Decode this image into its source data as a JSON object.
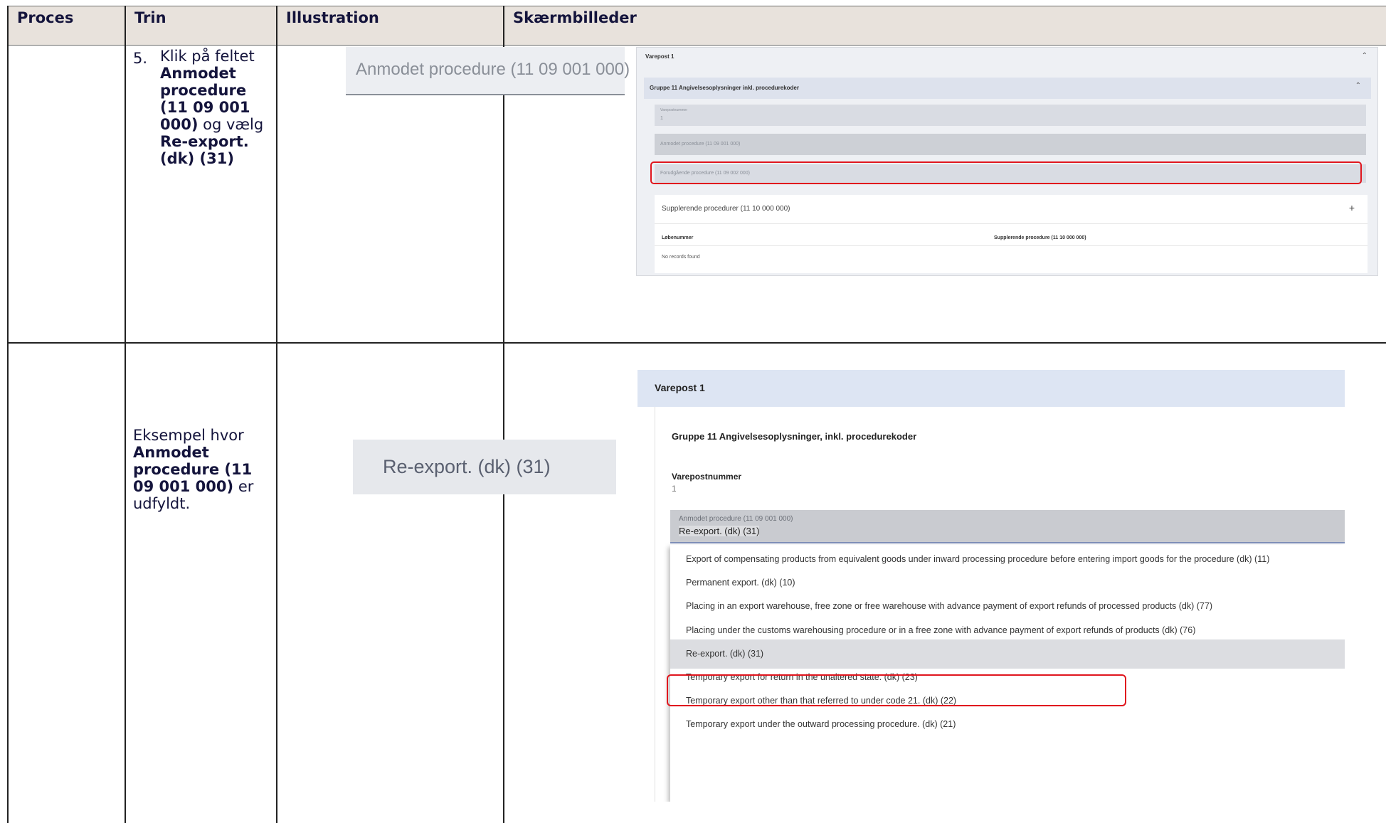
{
  "header": {
    "columns": [
      "Proces",
      "Trin",
      "Illustration",
      "Skærmbilleder"
    ]
  },
  "row1": {
    "step_number": "5.",
    "text_1": "Klik på feltet",
    "bold_1": "Anmodet procedure (11 09 001 000)",
    "text_2": "og vælg",
    "bold_2": "Re-export. (dk) (31)",
    "illustration_text": "Anmodet procedure (11 09 001 000)",
    "screenshot": {
      "title": "Varepost 1",
      "group_title": "Gruppe 11 Angivelsesoplysninger inkl. procedurekoder",
      "field_varepostnummer_label": "Varepostnummer",
      "field_varepostnummer_value": "1",
      "field_anmodet": "Anmodet procedure (11 09 001 000)",
      "field_forudgaaende": "Forudgående procedure (11 09 002 000)",
      "sub_title": "Supplerende procedurer (11 10 000 000)",
      "col_loebenummer": "Løbenummer",
      "col_supplerende": "Supplerende procedure (11 10 000 000)",
      "no_records": "No records found"
    }
  },
  "row2": {
    "text_1": "Eksempel hvor",
    "bold_1": "Anmodet procedure (11 09 001 000)",
    "text_2": "er udfyldt.",
    "illustration_text": "Re-export. (dk) (31)",
    "screenshot": {
      "title": "Varepost 1",
      "group_title": "Gruppe 11 Angivelsesoplysninger, inkl. procedurekoder",
      "varepostnummer_label": "Varepostnummer",
      "varepostnummer_value": "1",
      "select_label": "Anmodet procedure (11 09 001 000)",
      "select_value": "Re-export. (dk) (31)",
      "options": [
        "Export of compensating products from equivalent goods under inward processing procedure before entering import goods for the procedure (dk) (11)",
        "Permanent export. (dk) (10)",
        "Placing in an export warehouse, free zone or free warehouse with advance payment of export refunds of processed products (dk) (77)",
        "Placing under the customs warehousing procedure or in a free zone with advance payment of export refunds of products (dk) (76)",
        "Re-export. (dk) (31)",
        "Temporary export for return in the unaltered state. (dk) (23)",
        "Temporary export other than that referred to under code 21. (dk) (22)",
        "Temporary export under the outward processing procedure. (dk) (21)"
      ]
    }
  }
}
